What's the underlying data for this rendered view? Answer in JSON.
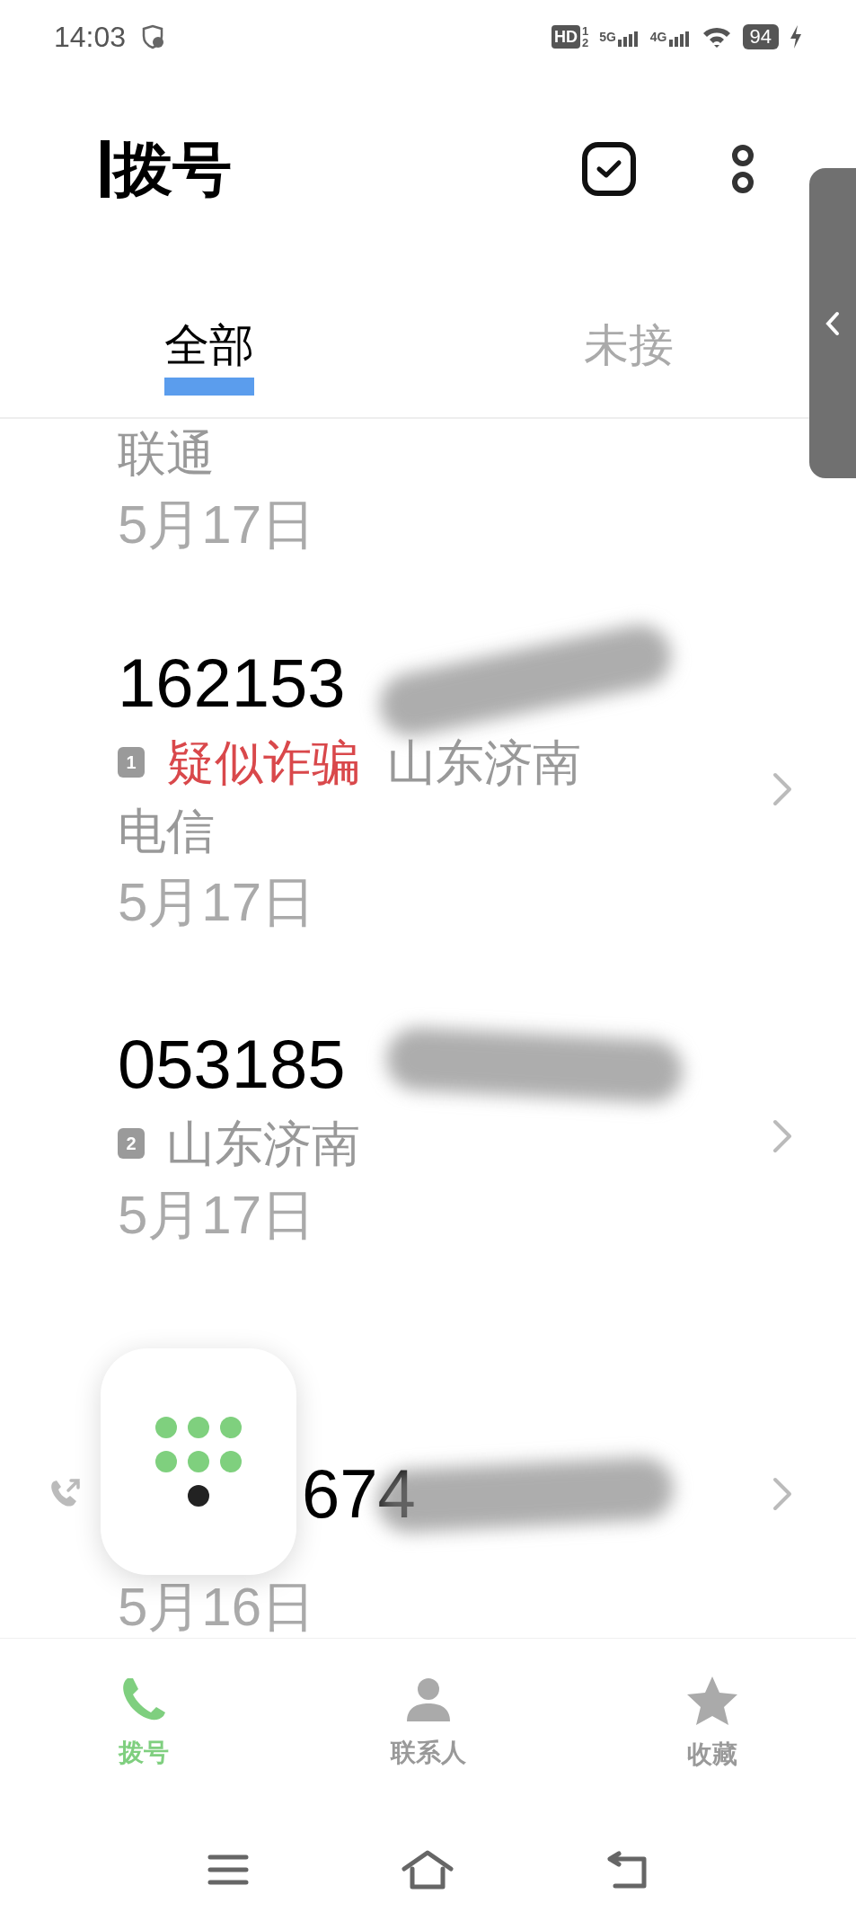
{
  "status_bar": {
    "time": "14:03",
    "hd": "HD",
    "sim_slots": [
      "1",
      "2"
    ],
    "networks": [
      "5G",
      "4G"
    ],
    "battery": "94"
  },
  "header": {
    "title": "拨号"
  },
  "tabs": [
    {
      "label": "全部",
      "selected": true
    },
    {
      "label": "未接",
      "selected": false
    }
  ],
  "calls": [
    {
      "carrier": "联通",
      "date": "5月17日"
    },
    {
      "number": "162153",
      "sim": "1",
      "tag": "疑似诈骗",
      "location": "山东济南",
      "carrier": "电信",
      "date": "5月17日",
      "redacted": true
    },
    {
      "number": "053185",
      "sim": "2",
      "location": "山东济南",
      "date": "5月17日",
      "redacted": true
    },
    {
      "number": "674",
      "outgoing": true,
      "date": "5月16日",
      "redacted": true
    }
  ],
  "bottom_nav": [
    {
      "label": "拨号",
      "selected": true
    },
    {
      "label": "联系人",
      "selected": false
    },
    {
      "label": "收藏",
      "selected": false
    }
  ]
}
